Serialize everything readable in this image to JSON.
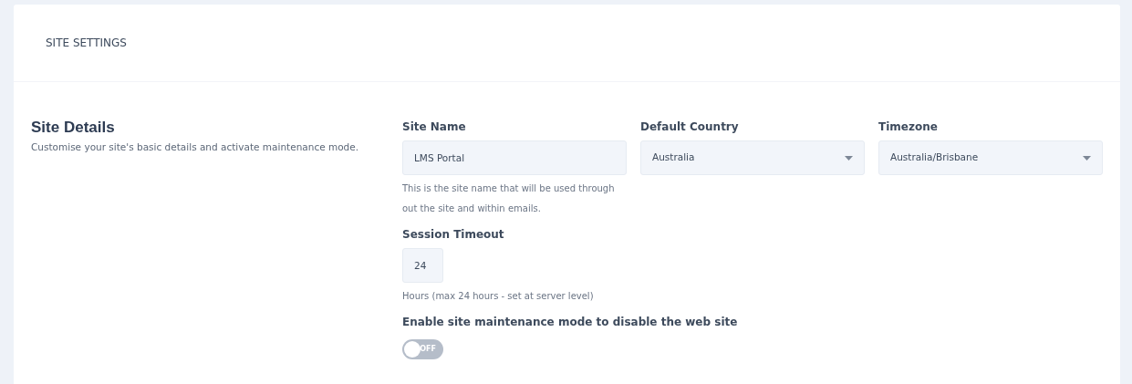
{
  "card_title": "SITE SETTINGS",
  "section": {
    "title": "Site Details",
    "description": "Customise your site's basic details and activate maintenance mode."
  },
  "fields": [
    {
      "kind": "text",
      "label": "Site Name",
      "value": "LMS Portal",
      "help": "This is the site name that will be used through out the site and within emails."
    },
    {
      "kind": "select",
      "label": "Default Country",
      "value": "Australia"
    },
    {
      "kind": "select",
      "label": "Timezone",
      "value": "Australia/Brisbane"
    }
  ],
  "session": {
    "label": "Session Timeout",
    "value": "24",
    "help": "Hours (max 24 hours - set at server level)"
  },
  "maintenance": {
    "label": "Enable site maintenance mode to disable the web site",
    "on": false,
    "state_label": "OFF"
  }
}
